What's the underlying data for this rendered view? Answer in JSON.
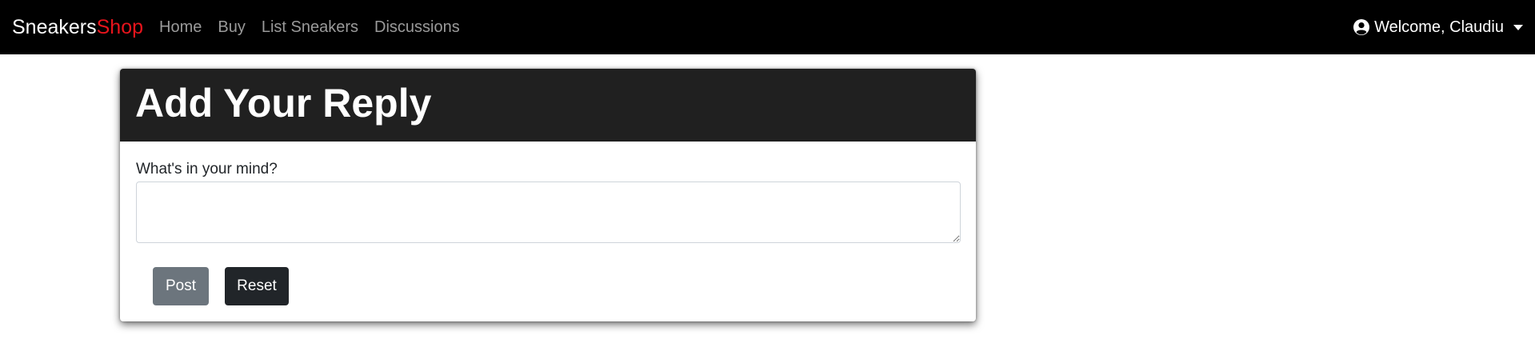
{
  "navbar": {
    "brand_main": "Sneakers",
    "brand_accent": "Shop",
    "links": [
      "Home",
      "Buy",
      "List Sneakers",
      "Discussions"
    ],
    "user_greeting": "Welcome, Claudiu",
    "user_icon": "user-circle-icon"
  },
  "reply_form": {
    "title": "Add Your Reply",
    "label": "What's in your mind?",
    "text_value": "",
    "post_label": "Post",
    "reset_label": "Reset"
  },
  "colors": {
    "navbar_bg": "#000000",
    "brand_accent": "#e8141c",
    "card_header_bg": "#202020",
    "post_button": "#6c757d",
    "reset_button": "#212529"
  }
}
